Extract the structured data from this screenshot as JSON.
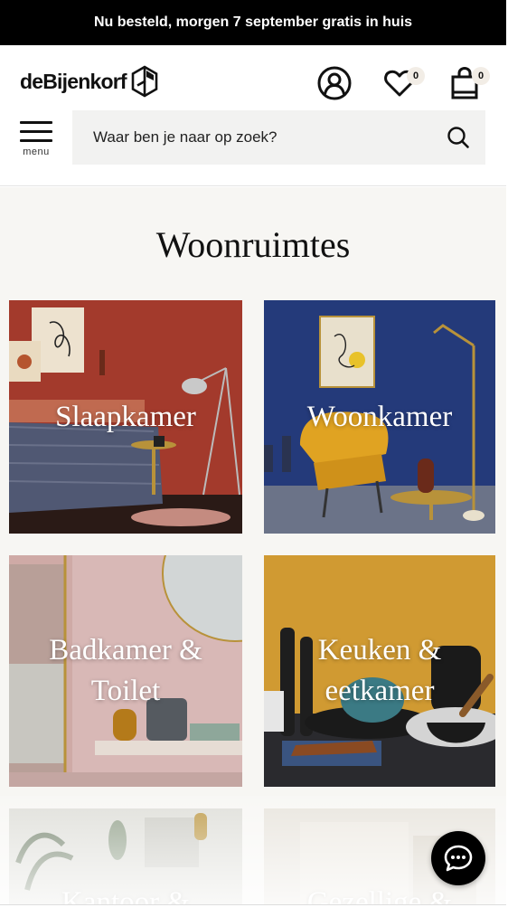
{
  "promo": {
    "text": "Nu besteld, morgen 7 september gratis in huis"
  },
  "header": {
    "logo_text": "deBijenkorf",
    "wishlist_count": "0",
    "cart_count": "0",
    "menu_label": "menu",
    "search_placeholder": "Waar ben je naar op zoek?"
  },
  "main": {
    "title": "Woonruimtes",
    "tiles": [
      {
        "label": "Slaapkamer"
      },
      {
        "label": "Woonkamer"
      },
      {
        "label": "Badkamer & Toilet"
      },
      {
        "label": "Keuken & eetkamer"
      },
      {
        "label": "Kantoor &"
      },
      {
        "label": "Gezellige &"
      }
    ]
  },
  "colors": {
    "promo_bg": "#000000",
    "page_bg": "#f7f6f3",
    "search_bg": "#f2f2f1",
    "slaapkamer_wall": "#a33a2c",
    "woonkamer_wall": "#243a7a",
    "badkamer_wall": "#d8b8b6",
    "keuken_wall": "#d09a32"
  },
  "icons": {
    "logo": "bijenkorf-hexagon-icon",
    "account": "user-icon",
    "wishlist": "heart-icon",
    "cart": "shopping-bag-icon",
    "menu": "hamburger-icon",
    "search": "search-icon",
    "chat": "chat-icon"
  }
}
